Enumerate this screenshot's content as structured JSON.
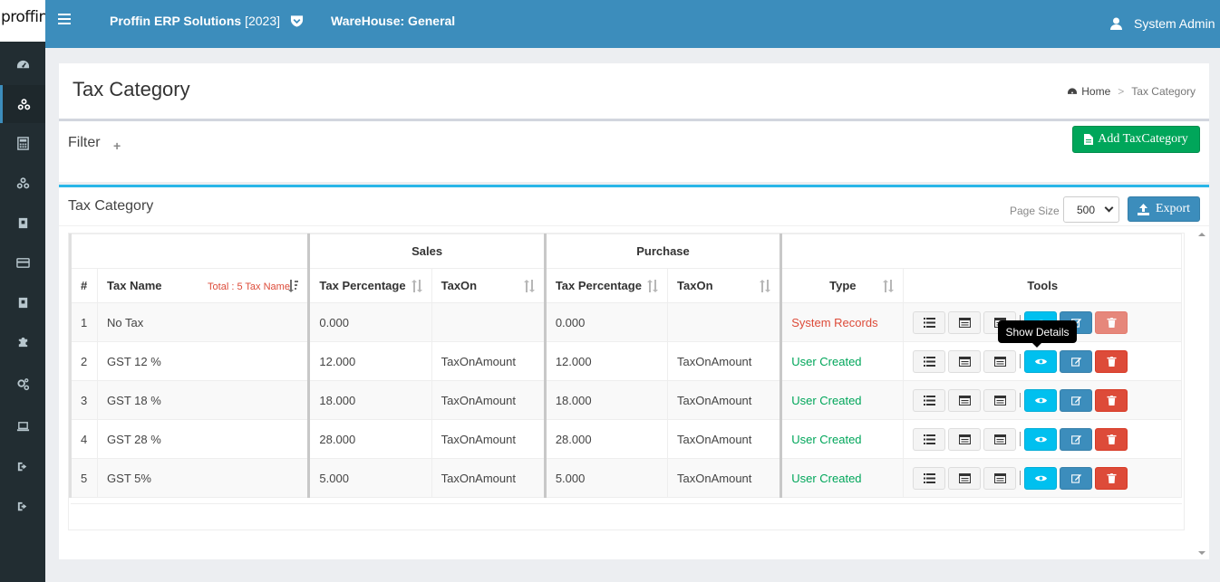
{
  "header": {
    "logo_text": "proffin",
    "app_name": "Proffin ERP Solutions",
    "app_year": "[2023]",
    "warehouse": "WareHouse: General",
    "user": "System Admin"
  },
  "sidebar": {
    "items": [
      {
        "icon": "dashboard-icon"
      },
      {
        "icon": "cubes-icon",
        "active": true
      },
      {
        "icon": "calculator-icon"
      },
      {
        "icon": "cubes-icon"
      },
      {
        "icon": "archive-icon"
      },
      {
        "icon": "credit-card-icon"
      },
      {
        "icon": "archive-icon"
      },
      {
        "icon": "puzzle-icon"
      },
      {
        "icon": "cogs-icon"
      },
      {
        "icon": "laptop-icon"
      },
      {
        "icon": "sign-out-icon"
      },
      {
        "icon": "sign-out-icon"
      }
    ]
  },
  "page": {
    "title": "Tax Category",
    "breadcrumb_home": "Home",
    "breadcrumb_current": "Tax Category"
  },
  "filter": {
    "title": "Filter",
    "add_button": "Add TaxCategory"
  },
  "list": {
    "title": "Tax Category",
    "page_size_label": "Page Size",
    "page_size": "500",
    "export_button": "Export",
    "group_headers": {
      "sales": "Sales",
      "purchase": "Purchase"
    },
    "columns": {
      "num": "#",
      "tax_name": "Tax Name",
      "total_note": "Total : 5 Tax Name",
      "sales_pct": "Tax Percentage",
      "sales_on": "TaxOn",
      "purchase_pct": "Tax Percentage",
      "purchase_on": "TaxOn",
      "type": "Type",
      "tools": "Tools"
    },
    "rows": [
      {
        "num": "1",
        "name": "No Tax",
        "sales_pct": "0.000",
        "sales_on": "",
        "purchase_pct": "0.000",
        "purchase_on": "",
        "type": "System Records"
      },
      {
        "num": "2",
        "name": "GST 12 %",
        "sales_pct": "12.000",
        "sales_on": "TaxOnAmount",
        "purchase_pct": "12.000",
        "purchase_on": "TaxOnAmount",
        "type": "User Created"
      },
      {
        "num": "3",
        "name": "GST 18 %",
        "sales_pct": "18.000",
        "sales_on": "TaxOnAmount",
        "purchase_pct": "18.000",
        "purchase_on": "TaxOnAmount",
        "type": "User Created"
      },
      {
        "num": "4",
        "name": "GST 28 %",
        "sales_pct": "28.000",
        "sales_on": "TaxOnAmount",
        "purchase_pct": "28.000",
        "purchase_on": "TaxOnAmount",
        "type": "User Created"
      },
      {
        "num": "5",
        "name": "GST 5%",
        "sales_pct": "5.000",
        "sales_on": "TaxOnAmount",
        "purchase_pct": "5.000",
        "purchase_on": "TaxOnAmount",
        "type": "User Created"
      }
    ],
    "tooltip": "Show Details"
  },
  "colors": {
    "header_bg": "#3c8dbc",
    "sidebar_bg": "#222d32",
    "success": "#00a65a",
    "danger": "#dd4b39",
    "info": "#00c0ef"
  }
}
